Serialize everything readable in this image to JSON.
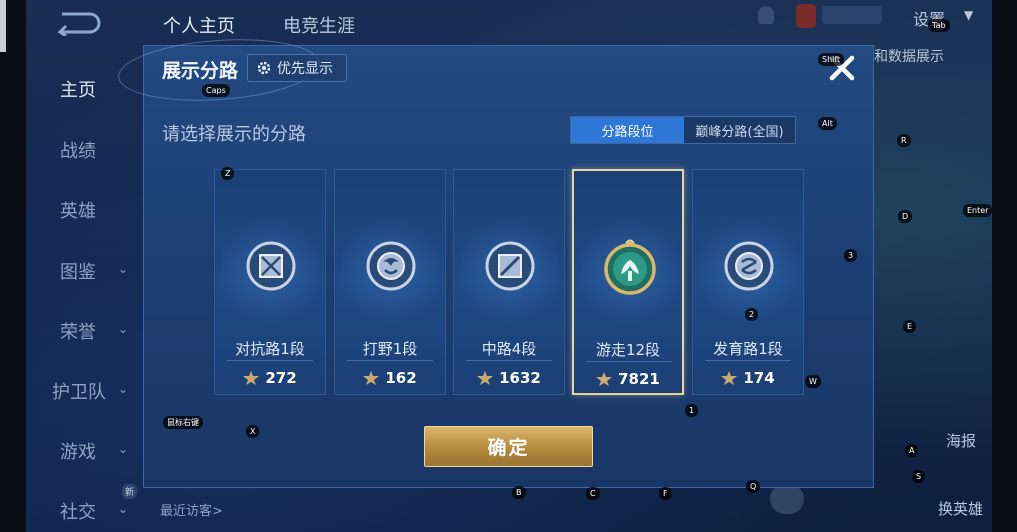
{
  "top_nav": {
    "tabs": [
      "个人主页",
      "电竞生涯"
    ],
    "settings_label": "设置"
  },
  "sidebar": {
    "items": [
      {
        "label": "主页",
        "active": true
      },
      {
        "label": "战绩"
      },
      {
        "label": "英雄"
      },
      {
        "label": "图鉴",
        "expandable": true
      },
      {
        "label": "荣誉",
        "expandable": true
      },
      {
        "label": "护卫队",
        "expandable": true
      },
      {
        "label": "游戏",
        "expandable": true
      },
      {
        "label": "社交",
        "expandable": true
      }
    ],
    "new_badge": "新",
    "visitor_text": "最近访客>"
  },
  "background_peek": {
    "right_text": "和数据展示",
    "poster_label": "海报",
    "swap_hero_label": "换英雄"
  },
  "modal": {
    "title": "展示分路",
    "priority_button": "优先显示",
    "prompt": "请选择展示的分路",
    "tabs": [
      {
        "label": "分路段位",
        "active": true
      },
      {
        "label": "巅峰分路(全国)",
        "active": false
      }
    ],
    "cards": [
      {
        "label": "对抗路1段",
        "score": "272",
        "icon": "clash-lane-emblem-icon",
        "selected": false
      },
      {
        "label": "打野1段",
        "score": "162",
        "icon": "jungle-emblem-icon",
        "selected": false
      },
      {
        "label": "中路4段",
        "score": "1632",
        "icon": "mid-lane-emblem-icon",
        "selected": false
      },
      {
        "label": "游走12段",
        "score": "7821",
        "icon": "roam-emblem-icon",
        "selected": true
      },
      {
        "label": "发育路1段",
        "score": "174",
        "icon": "farm-lane-emblem-icon",
        "selected": false
      }
    ],
    "confirm_label": "确定"
  },
  "key_hints": [
    {
      "key": "Caps"
    },
    {
      "key": "Shift"
    },
    {
      "key": "Tab"
    },
    {
      "key": "Alt"
    },
    {
      "key": "R"
    },
    {
      "key": "D"
    },
    {
      "key": "Enter"
    },
    {
      "key": "3"
    },
    {
      "key": "2"
    },
    {
      "key": "E"
    },
    {
      "key": "W"
    },
    {
      "key": "1"
    },
    {
      "key": "Z"
    },
    {
      "key": "X"
    },
    {
      "key": "鼠标右键"
    },
    {
      "key": "A"
    },
    {
      "key": "S"
    },
    {
      "key": "B"
    },
    {
      "key": "C"
    },
    {
      "key": "F"
    },
    {
      "key": "Q"
    }
  ],
  "colors": {
    "modal_bg": "#1f4478",
    "accent_blue": "#2f77d6",
    "gold": "#c9a35a",
    "selected_border": "#e6d4a4"
  }
}
